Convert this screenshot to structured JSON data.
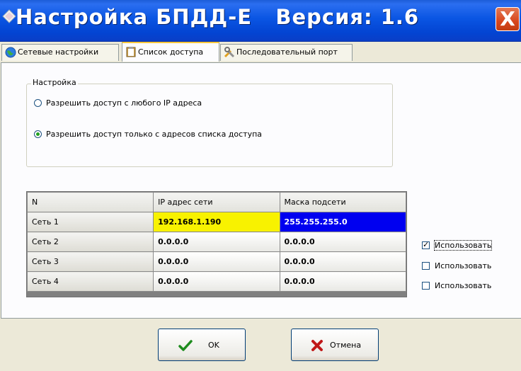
{
  "window": {
    "title": "Настройка БПДД-Е   Версия: 1.6",
    "close_glyph": "X"
  },
  "tabs": [
    {
      "label": "Сетевые настройки",
      "icon": "globe-icon"
    },
    {
      "label": "Список доступа",
      "icon": "clipboard-icon",
      "active": true
    },
    {
      "label": "Последовательный порт",
      "icon": "tools-icon"
    }
  ],
  "settings_group": {
    "title": "Настройка",
    "options": [
      {
        "label": "Разрешить доступ с любого IP адреса",
        "selected": false
      },
      {
        "label": "Разрешить доступ только с адресов списка доступа",
        "selected": true
      }
    ]
  },
  "access_table": {
    "columns": [
      "N",
      "IP адрес сети",
      "Маска подсети"
    ],
    "rows": [
      {
        "name": "Сеть 1",
        "ip": "192.168.1.190",
        "mask": "255.255.255.0"
      },
      {
        "name": "Сеть 2",
        "ip": "0.0.0.0",
        "mask": "0.0.0.0"
      },
      {
        "name": "Сеть 3",
        "ip": "0.0.0.0",
        "mask": "0.0.0.0"
      },
      {
        "name": "Сеть 4",
        "ip": "0.0.0.0",
        "mask": "0.0.0.0"
      }
    ],
    "use_checkboxes": [
      {
        "label": "Использовать",
        "checked": true
      },
      {
        "label": "Использовать",
        "checked": false
      },
      {
        "label": "Использовать",
        "checked": false
      }
    ]
  },
  "buttons": {
    "ok_label": "OK",
    "cancel_label": "Отмена"
  },
  "colors": {
    "titlebar": "#0a55e3",
    "selected_ip_cell": "#f8f200",
    "selected_mask_cell": "#0000f0"
  }
}
